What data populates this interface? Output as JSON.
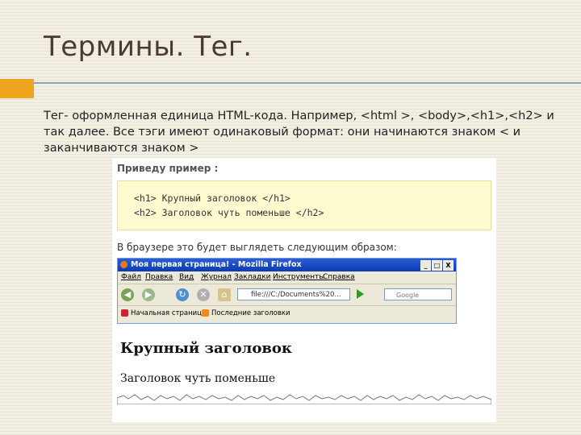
{
  "slide": {
    "title": "Термины. Тег.",
    "body_text": "Тег- оформленная единица HTML-кода. Например, <html >, <body>,<h1>,<h2> и так далее. Все тэги имеют одинаковый формат: они начинаются знаком < и заканчиваются знаком >",
    "accent_color": "#f0a31c"
  },
  "example": {
    "label": "Приведу пример :",
    "code_line_1": "<h1> Крупный заголовок </h1>",
    "code_line_2": "<h2> Заголовок чуть поменьше </h2>",
    "browser_caption": "В браузере это будет выглядеть следующим образом:"
  },
  "browser": {
    "window_title": "Моя первая страница! - Mozilla Firefox",
    "window_buttons": [
      "_",
      "□",
      "X"
    ],
    "menu": [
      "Файл",
      "Правка",
      "Вид",
      "Журнал",
      "Закладки",
      "Инструменты",
      "Справка"
    ],
    "address": "file:///C:/Documents%20...",
    "search_placeholder": "Google",
    "bookmarks": [
      "Начальная страница",
      "Последние заголовки"
    ],
    "icons": [
      "back-arrow-icon",
      "forward-arrow-icon",
      "reload-icon",
      "stop-icon",
      "home-icon",
      "go-icon"
    ]
  },
  "rendered": {
    "h1": "Крупный заголовок",
    "h2": "Заголовок чуть поменьше"
  }
}
